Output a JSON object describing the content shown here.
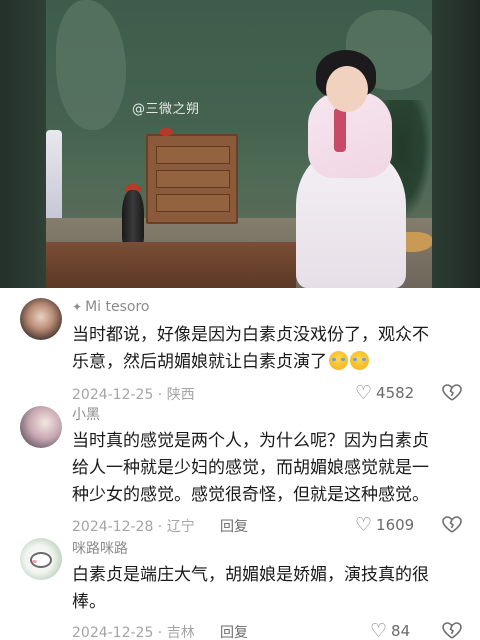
{
  "video": {
    "watermark": "@三微之朔"
  },
  "comments": [
    {
      "username": "Mi    tesoro",
      "user_mark": "✦",
      "text": "当时都说，好像是因为白素贞没戏份了，观众不乐意，然后胡媚娘就让白素贞演了",
      "emojis": [
        "crying-face-icon",
        "crying-face-icon"
      ],
      "date_location": "2024-12-25 · 陕西",
      "reply_label": "",
      "likes": "4582"
    },
    {
      "username": "小黑",
      "text": "当时真的感觉是两个人，为什么呢？因为白素贞给人一种就是少妇的感觉，而胡媚娘感觉就是一种少女的感觉。感觉很奇怪，但就是这种感觉。",
      "date_location": "2024-12-28 · 辽宁",
      "reply_label": "回复",
      "likes": "1609"
    },
    {
      "username": "咪路咪路",
      "text": "白素贞是端庄大气，胡媚娘是娇媚，演技真的很棒。",
      "date_location": "2024-12-25 · 吉林",
      "reply_label": "回复",
      "likes": "84"
    }
  ]
}
